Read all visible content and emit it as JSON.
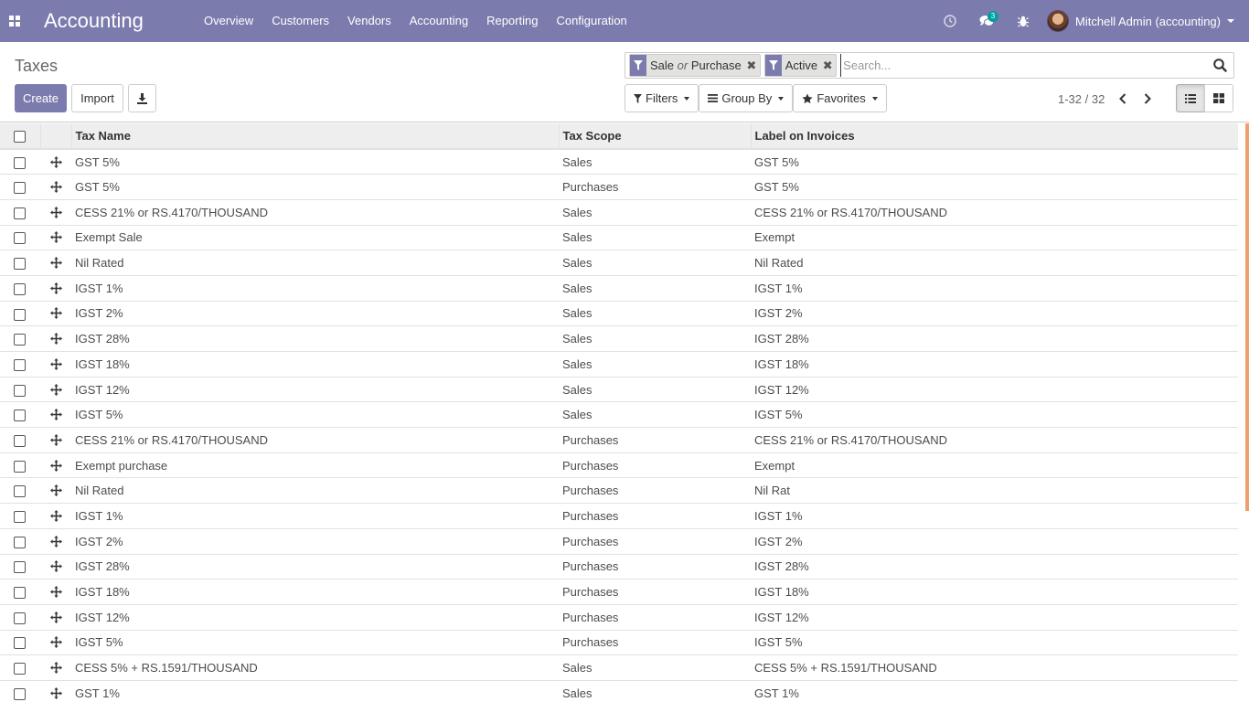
{
  "navbar": {
    "brand": "Accounting",
    "menu": [
      "Overview",
      "Customers",
      "Vendors",
      "Accounting",
      "Reporting",
      "Configuration"
    ],
    "messages_count": "3",
    "user_name": "Mitchell Admin (accounting)",
    "bg_color": "#7c7bad"
  },
  "control": {
    "breadcrumb": "Taxes",
    "create_label": "Create",
    "import_label": "Import",
    "search": {
      "facets": [
        {
          "values": [
            {
              "text": "Sale"
            },
            {
              "text": "or",
              "sep": true
            },
            {
              "text": "Purchase"
            }
          ]
        },
        {
          "values": [
            {
              "text": "Active"
            }
          ]
        }
      ],
      "placeholder": "Search..."
    },
    "filters_label": "Filters",
    "groupby_label": "Group By",
    "favorites_label": "Favorites",
    "pager": "1-32 / 32",
    "active_view": "list"
  },
  "list": {
    "columns": [
      "Tax Name",
      "Tax Scope",
      "Label on Invoices"
    ],
    "rows": [
      {
        "name": "GST 5%",
        "scope": "Sales",
        "label": "GST 5%"
      },
      {
        "name": "GST 5%",
        "scope": "Purchases",
        "label": "GST 5%"
      },
      {
        "name": "CESS 21% or RS.4170/THOUSAND",
        "scope": "Sales",
        "label": "CESS 21% or RS.4170/THOUSAND"
      },
      {
        "name": "Exempt Sale",
        "scope": "Sales",
        "label": "Exempt"
      },
      {
        "name": "Nil Rated",
        "scope": "Sales",
        "label": "Nil Rated"
      },
      {
        "name": "IGST 1%",
        "scope": "Sales",
        "label": "IGST 1%"
      },
      {
        "name": "IGST 2%",
        "scope": "Sales",
        "label": "IGST 2%"
      },
      {
        "name": "IGST 28%",
        "scope": "Sales",
        "label": "IGST 28%"
      },
      {
        "name": "IGST 18%",
        "scope": "Sales",
        "label": "IGST 18%"
      },
      {
        "name": "IGST 12%",
        "scope": "Sales",
        "label": "IGST 12%"
      },
      {
        "name": "IGST 5%",
        "scope": "Sales",
        "label": "IGST 5%"
      },
      {
        "name": "CESS 21% or RS.4170/THOUSAND",
        "scope": "Purchases",
        "label": "CESS 21% or RS.4170/THOUSAND"
      },
      {
        "name": "Exempt purchase",
        "scope": "Purchases",
        "label": "Exempt"
      },
      {
        "name": "Nil Rated",
        "scope": "Purchases",
        "label": "Nil Rat"
      },
      {
        "name": "IGST 1%",
        "scope": "Purchases",
        "label": "IGST 1%"
      },
      {
        "name": "IGST 2%",
        "scope": "Purchases",
        "label": "IGST 2%"
      },
      {
        "name": "IGST 28%",
        "scope": "Purchases",
        "label": "IGST 28%"
      },
      {
        "name": "IGST 18%",
        "scope": "Purchases",
        "label": "IGST 18%"
      },
      {
        "name": "IGST 12%",
        "scope": "Purchases",
        "label": "IGST 12%"
      },
      {
        "name": "IGST 5%",
        "scope": "Purchases",
        "label": "IGST 5%"
      },
      {
        "name": "CESS 5% + RS.1591/THOUSAND",
        "scope": "Sales",
        "label": "CESS 5% + RS.1591/THOUSAND"
      },
      {
        "name": "GST 1%",
        "scope": "Sales",
        "label": "GST 1%"
      }
    ]
  }
}
